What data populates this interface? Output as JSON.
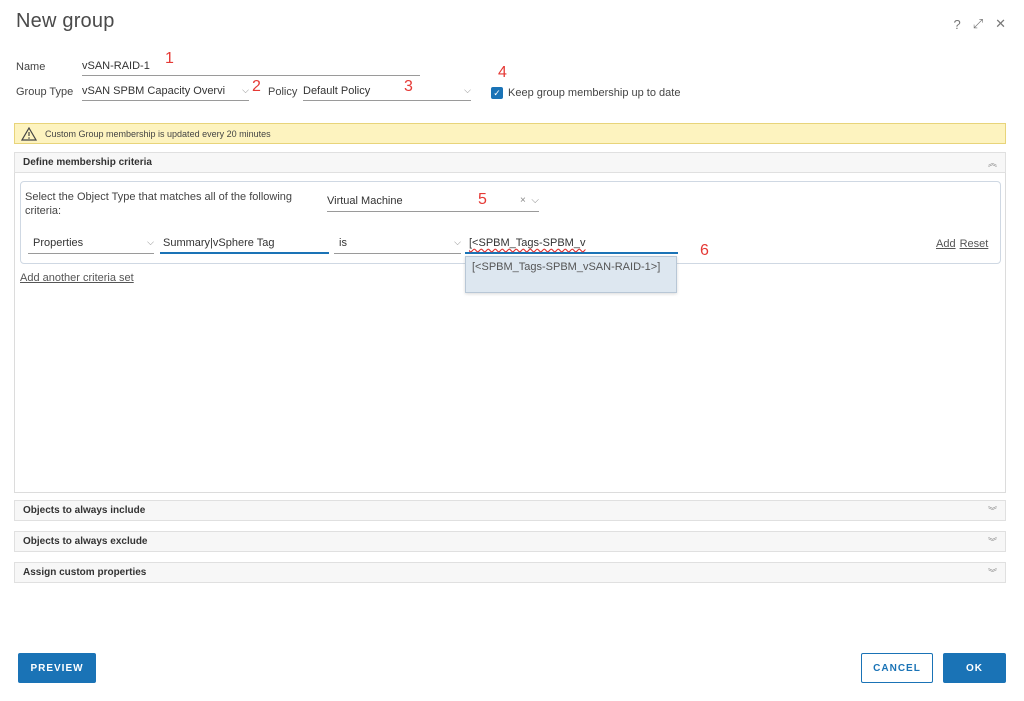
{
  "dialog": {
    "title": "New group",
    "help_glyph": "?",
    "expand_glyph": "⤢",
    "close_glyph": "✕"
  },
  "form": {
    "name_label": "Name",
    "name_value": "vSAN-RAID-1",
    "group_type_label": "Group Type",
    "group_type_value": "vSAN SPBM Capacity Overvi",
    "policy_label": "Policy",
    "policy_value": "Default Policy",
    "keep_membership_label": "Keep group membership up to date",
    "keep_membership_checked": true
  },
  "annotations": {
    "a1": "1",
    "a2": "2",
    "a3": "3",
    "a4": "4",
    "a5": "5",
    "a6": "6"
  },
  "warning": {
    "text": "Custom Group membership is updated every 20 minutes"
  },
  "sections": {
    "define": "Define membership criteria",
    "include": "Objects to always include",
    "exclude": "Objects to always exclude",
    "custom": "Assign custom properties"
  },
  "criteria": {
    "select_text": "Select the Object Type that matches all of the following criteria:",
    "object_type": "Virtual Machine",
    "clear_glyph": "×",
    "row": {
      "category": "Properties",
      "property": "Summary|vSphere Tag",
      "operator": "is",
      "value": "[<SPBM_Tags-SPBM_v"
    },
    "suggestion": "[<SPBM_Tags-SPBM_vSAN-RAID-1>]",
    "add_label": "Add",
    "reset_label": "Reset",
    "add_set_label": "Add another criteria set"
  },
  "buttons": {
    "preview": "PREVIEW",
    "cancel": "CANCEL",
    "ok": "OK"
  }
}
